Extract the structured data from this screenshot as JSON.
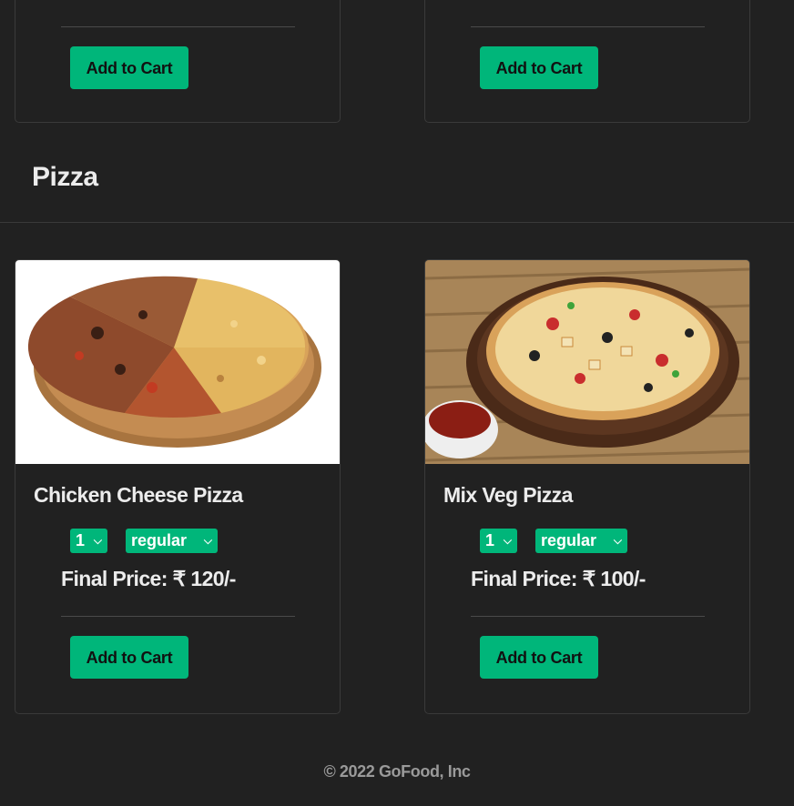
{
  "top_cards": [
    {
      "cart_label": "Add to Cart"
    },
    {
      "cart_label": "Add to Cart"
    }
  ],
  "section": {
    "title": "Pizza"
  },
  "items": [
    {
      "name": "Chicken Cheese Pizza",
      "image": "chicken-cheese-pizza-photo",
      "quantity": "1",
      "size": "regular",
      "price_label": "Final Price:",
      "price_value": "₹ 120/-",
      "cart_label": "Add to Cart"
    },
    {
      "name": "Mix Veg Pizza",
      "image": "mix-veg-pizza-photo",
      "quantity": "1",
      "size": "regular",
      "price_label": "Final Price:",
      "price_value": "₹ 100/-",
      "cart_label": "Add to Cart"
    }
  ],
  "footer": {
    "copyright": "© 2022 GoFood, Inc"
  },
  "colors": {
    "background": "#212121",
    "accent": "#00b67a",
    "card_border": "#3a3a3a"
  }
}
